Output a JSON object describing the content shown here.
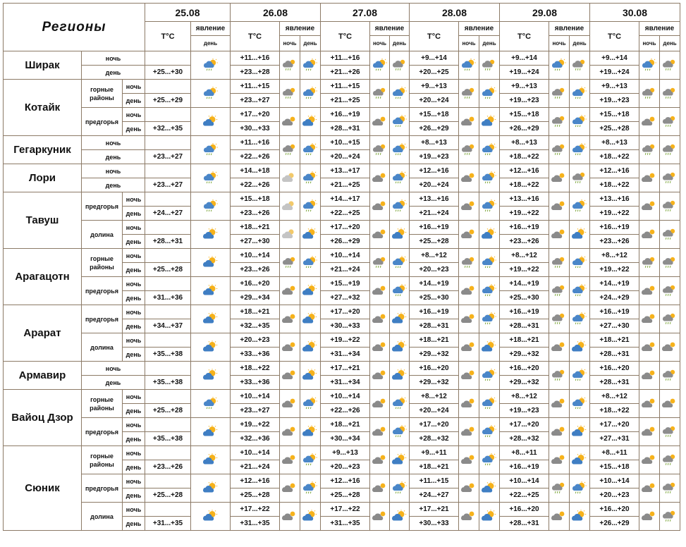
{
  "header": {
    "regions_title": "Регионы",
    "temp_label": "Т°С",
    "phenomenon_label": "явление",
    "night_label": "ночь",
    "day_label": "день",
    "dates": [
      "25.08",
      "26.08",
      "27.08",
      "28.08",
      "29.08",
      "30.08"
    ]
  },
  "labels": {
    "night": "ночь",
    "day": "день",
    "mountain": "горные районы",
    "foothills": "предгорья",
    "valley": "долина"
  },
  "regions": [
    {
      "name": "Ширак",
      "zones": [
        {
          "zone": "",
          "temps": [
            {
              "night": "",
              "day": "+25...+30"
            },
            {
              "night": "+11...+16",
              "day": "+23...+28"
            },
            {
              "night": "+11...+16",
              "day": "+21...+26"
            },
            {
              "night": "+9...+14",
              "day": "+20...+25"
            },
            {
              "night": "+9...+14",
              "day": "+19...+24"
            },
            {
              "night": "+9...+14",
              "day": "+19...+24"
            }
          ],
          "icons": [
            "sun-cloud-rain-icon",
            "rain-cloud-icon",
            "sun-cloud-rain-icon",
            "sun-cloud-rain-icon",
            "rain-cloud-icon",
            "sun-cloud-rain-icon",
            "rain-cloud-icon",
            "sun-cloud-rain-icon",
            "rain-cloud-icon",
            "sun-cloud-rain-icon",
            "rain-cloud-icon"
          ]
        }
      ]
    },
    {
      "name": "Котайк",
      "zones": [
        {
          "zone": "mountain",
          "temps": [
            {
              "night": "",
              "day": "+25...+29"
            },
            {
              "night": "+11...+15",
              "day": "+23...+27"
            },
            {
              "night": "+11...+15",
              "day": "+21...+25"
            },
            {
              "night": "+9...+13",
              "day": "+20...+24"
            },
            {
              "night": "+9...+13",
              "day": "+19...+23"
            },
            {
              "night": "+9...+13",
              "day": "+19...+23"
            }
          ],
          "icons": [
            "sun-cloud-rain-icon",
            "rain-cloud-icon",
            "sun-cloud-rain-icon",
            "rain-cloud-icon",
            "sun-cloud-rain-icon",
            "rain-cloud-icon",
            "sun-cloud-rain-icon",
            "rain-cloud-icon",
            "sun-cloud-rain-icon",
            "rain-cloud-icon",
            "rain-cloud-icon"
          ]
        },
        {
          "zone": "foothills",
          "temps": [
            {
              "night": "",
              "day": "+32...+35"
            },
            {
              "night": "+17...+20",
              "day": "+30...+33"
            },
            {
              "night": "+16...+19",
              "day": "+28...+31"
            },
            {
              "night": "+15...+18",
              "day": "+26...+29"
            },
            {
              "night": "+15...+18",
              "day": "+26...+29"
            },
            {
              "night": "+15...+18",
              "day": "+25...+28"
            }
          ],
          "icons": [
            "sun-cloud-icon",
            "cloud-icon",
            "sun-cloud-icon",
            "cloud-icon",
            "sun-cloud-rain-icon",
            "cloud-icon",
            "sun-cloud-icon",
            "rain-cloud-icon",
            "sun-cloud-rain-icon",
            "cloud-icon",
            "rain-cloud-icon"
          ]
        }
      ]
    },
    {
      "name": "Гегаркуник",
      "zones": [
        {
          "zone": "",
          "temps": [
            {
              "night": "",
              "day": "+23...+27"
            },
            {
              "night": "+11...+16",
              "day": "+22...+26"
            },
            {
              "night": "+10...+15",
              "day": "+20...+24"
            },
            {
              "night": "+8...+13",
              "day": "+19...+23"
            },
            {
              "night": "+8...+13",
              "day": "+18...+22"
            },
            {
              "night": "+8...+13",
              "day": "+18...+22"
            }
          ],
          "icons": [
            "sun-cloud-rain-icon",
            "rain-cloud-icon",
            "sun-cloud-rain-icon",
            "rain-cloud-icon",
            "sun-cloud-rain-icon",
            "rain-cloud-icon",
            "sun-cloud-rain-icon",
            "rain-cloud-icon",
            "sun-cloud-rain-icon",
            "rain-cloud-icon",
            "rain-cloud-icon"
          ]
        }
      ]
    },
    {
      "name": "Лори",
      "zones": [
        {
          "zone": "",
          "temps": [
            {
              "night": "",
              "day": "+23...+27"
            },
            {
              "night": "+14...+18",
              "day": "+22...+26"
            },
            {
              "night": "+13...+17",
              "day": "+21...+25"
            },
            {
              "night": "+12...+16",
              "day": "+20...+24"
            },
            {
              "night": "+12...+16",
              "day": "+18...+22"
            },
            {
              "night": "+12...+16",
              "day": "+18...+22"
            }
          ],
          "icons": [
            "sun-cloud-rain-icon",
            "moon-cloud-icon",
            "sun-cloud-rain-icon",
            "cloud-icon",
            "sun-cloud-rain-icon",
            "cloud-icon",
            "sun-cloud-rain-icon",
            "cloud-icon",
            "rain-cloud-icon",
            "cloud-icon",
            "rain-cloud-icon"
          ]
        }
      ]
    },
    {
      "name": "Тавуш",
      "zones": [
        {
          "zone": "foothills",
          "temps": [
            {
              "night": "",
              "day": "+24...+27"
            },
            {
              "night": "+15...+18",
              "day": "+23...+26"
            },
            {
              "night": "+14...+17",
              "day": "+22...+25"
            },
            {
              "night": "+13...+16",
              "day": "+21...+24"
            },
            {
              "night": "+13...+16",
              "day": "+19...+22"
            },
            {
              "night": "+13...+16",
              "day": "+19...+22"
            }
          ],
          "icons": [
            "sun-cloud-rain-icon",
            "moon-cloud-icon",
            "sun-cloud-rain-icon",
            "cloud-icon",
            "sun-cloud-rain-icon",
            "cloud-icon",
            "sun-cloud-rain-icon",
            "cloud-icon",
            "sun-cloud-rain-icon",
            "cloud-icon",
            "rain-cloud-icon"
          ]
        },
        {
          "zone": "valley",
          "temps": [
            {
              "night": "",
              "day": "+28...+31"
            },
            {
              "night": "+18...+21",
              "day": "+27...+30"
            },
            {
              "night": "+17...+20",
              "day": "+26...+29"
            },
            {
              "night": "+16...+19",
              "day": "+25...+28"
            },
            {
              "night": "+16...+19",
              "day": "+23...+26"
            },
            {
              "night": "+16...+19",
              "day": "+23...+26"
            }
          ],
          "icons": [
            "sun-cloud-icon",
            "moon-cloud-icon",
            "sun-cloud-icon",
            "cloud-icon",
            "sun-cloud-icon",
            "cloud-icon",
            "sun-cloud-icon",
            "cloud-icon",
            "sun-cloud-icon",
            "cloud-icon",
            "rain-cloud-icon"
          ]
        }
      ]
    },
    {
      "name": "Арагацотн",
      "zones": [
        {
          "zone": "mountain",
          "temps": [
            {
              "night": "",
              "day": "+25...+28"
            },
            {
              "night": "+10...+14",
              "day": "+23...+26"
            },
            {
              "night": "+10...+14",
              "day": "+21...+24"
            },
            {
              "night": "+8...+12",
              "day": "+20...+23"
            },
            {
              "night": "+8...+12",
              "day": "+19...+22"
            },
            {
              "night": "+8...+12",
              "day": "+19...+22"
            }
          ],
          "icons": [
            "sun-cloud-icon",
            "rain-cloud-icon",
            "sun-cloud-rain-icon",
            "rain-cloud-icon",
            "sun-cloud-rain-icon",
            "rain-cloud-icon",
            "sun-cloud-rain-icon",
            "rain-cloud-icon",
            "sun-cloud-rain-icon",
            "rain-cloud-icon",
            "rain-cloud-icon"
          ]
        },
        {
          "zone": "foothills",
          "temps": [
            {
              "night": "",
              "day": "+31...+36"
            },
            {
              "night": "+16...+20",
              "day": "+29...+34"
            },
            {
              "night": "+15...+19",
              "day": "+27...+32"
            },
            {
              "night": "+14...+19",
              "day": "+25...+30"
            },
            {
              "night": "+14...+19",
              "day": "+25...+30"
            },
            {
              "night": "+14...+19",
              "day": "+24...+29"
            }
          ],
          "icons": [
            "sun-cloud-icon",
            "cloud-icon",
            "sun-cloud-icon",
            "cloud-icon",
            "sun-cloud-rain-icon",
            "cloud-icon",
            "sun-cloud-rain-icon",
            "rain-cloud-icon",
            "sun-cloud-rain-icon",
            "cloud-icon",
            "rain-cloud-icon"
          ]
        }
      ]
    },
    {
      "name": "Арарат",
      "zones": [
        {
          "zone": "foothills",
          "temps": [
            {
              "night": "",
              "day": "+34...+37"
            },
            {
              "night": "+18...+21",
              "day": "+32...+35"
            },
            {
              "night": "+17...+20",
              "day": "+30...+33"
            },
            {
              "night": "+16...+19",
              "day": "+28...+31"
            },
            {
              "night": "+16...+19",
              "day": "+28...+31"
            },
            {
              "night": "+16...+19",
              "day": "+27...+30"
            }
          ],
          "icons": [
            "sun-cloud-icon",
            "cloud-icon",
            "sun-cloud-icon",
            "cloud-icon",
            "sun-cloud-icon",
            "cloud-icon",
            "sun-cloud-rain-icon",
            "rain-cloud-icon",
            "sun-cloud-rain-icon",
            "cloud-icon",
            "rain-cloud-icon"
          ]
        },
        {
          "zone": "valley",
          "temps": [
            {
              "night": "",
              "day": "+35...+38"
            },
            {
              "night": "+20...+23",
              "day": "+33...+36"
            },
            {
              "night": "+19...+22",
              "day": "+31...+34"
            },
            {
              "night": "+18...+21",
              "day": "+29...+32"
            },
            {
              "night": "+18...+21",
              "day": "+29...+32"
            },
            {
              "night": "+18...+21",
              "day": "+28...+31"
            }
          ],
          "icons": [
            "sun-cloud-icon",
            "cloud-icon",
            "sun-cloud-icon",
            "cloud-icon",
            "sun-cloud-icon",
            "cloud-icon",
            "sun-cloud-icon",
            "cloud-icon",
            "sun-cloud-icon",
            "cloud-icon",
            "cloud-icon"
          ]
        }
      ]
    },
    {
      "name": "Армавир",
      "zones": [
        {
          "zone": "",
          "temps": [
            {
              "night": "",
              "day": "+35...+38"
            },
            {
              "night": "+18...+22",
              "day": "+33...+36"
            },
            {
              "night": "+17...+21",
              "day": "+31...+34"
            },
            {
              "night": "+16...+20",
              "day": "+29...+32"
            },
            {
              "night": "+16...+20",
              "day": "+29...+32"
            },
            {
              "night": "+16...+20",
              "day": "+28...+31"
            }
          ],
          "icons": [
            "sun-cloud-icon",
            "cloud-icon",
            "sun-cloud-icon",
            "cloud-icon",
            "sun-cloud-icon",
            "cloud-icon",
            "sun-cloud-rain-icon",
            "rain-cloud-icon",
            "sun-cloud-rain-icon",
            "cloud-icon",
            "rain-cloud-icon"
          ]
        }
      ]
    },
    {
      "name": "Вайоц Дзор",
      "zones": [
        {
          "zone": "mountain",
          "temps": [
            {
              "night": "",
              "day": "+25...+28"
            },
            {
              "night": "+10...+14",
              "day": "+23...+27"
            },
            {
              "night": "+10...+14",
              "day": "+22...+26"
            },
            {
              "night": "+8...+12",
              "day": "+20...+24"
            },
            {
              "night": "+8...+12",
              "day": "+19...+23"
            },
            {
              "night": "+8...+12",
              "day": "+18...+22"
            }
          ],
          "icons": [
            "sun-cloud-rain-icon",
            "cloud-icon",
            "sun-cloud-rain-icon",
            "cloud-icon",
            "sun-cloud-rain-icon",
            "cloud-icon",
            "sun-cloud-rain-icon",
            "cloud-icon",
            "sun-cloud-rain-icon",
            "cloud-icon",
            "cloud-icon"
          ]
        },
        {
          "zone": "foothills",
          "temps": [
            {
              "night": "",
              "day": "+35...+38"
            },
            {
              "night": "+19...+22",
              "day": "+32...+36"
            },
            {
              "night": "+18...+21",
              "day": "+30...+34"
            },
            {
              "night": "+17...+20",
              "day": "+28...+32"
            },
            {
              "night": "+17...+20",
              "day": "+28...+32"
            },
            {
              "night": "+17...+20",
              "day": "+27...+31"
            }
          ],
          "icons": [
            "sun-cloud-icon",
            "cloud-icon",
            "sun-cloud-icon",
            "cloud-icon",
            "sun-cloud-rain-icon",
            "cloud-icon",
            "sun-cloud-rain-icon",
            "cloud-icon",
            "sun-cloud-icon",
            "cloud-icon",
            "rain-cloud-icon"
          ]
        }
      ]
    },
    {
      "name": "Сюник",
      "zones": [
        {
          "zone": "mountain",
          "temps": [
            {
              "night": "",
              "day": "+23...+26"
            },
            {
              "night": "+10...+14",
              "day": "+21...+24"
            },
            {
              "night": "+9...+13",
              "day": "+20...+23"
            },
            {
              "night": "+9...+11",
              "day": "+18...+21"
            },
            {
              "night": "+8...+11",
              "day": "+16...+19"
            },
            {
              "night": "+8...+11",
              "day": "+15...+18"
            }
          ],
          "icons": [
            "sun-cloud-icon",
            "cloud-icon",
            "sun-cloud-rain-icon",
            "cloud-icon",
            "sun-cloud-icon",
            "cloud-icon",
            "sun-cloud-rain-icon",
            "cloud-icon",
            "sun-cloud-icon",
            "cloud-icon",
            "rain-cloud-icon"
          ]
        },
        {
          "zone": "foothills",
          "temps": [
            {
              "night": "",
              "day": "+25...+28"
            },
            {
              "night": "+12...+16",
              "day": "+25...+28"
            },
            {
              "night": "+12...+16",
              "day": "+25...+28"
            },
            {
              "night": "+11...+15",
              "day": "+24...+27"
            },
            {
              "night": "+10...+14",
              "day": "+22...+25"
            },
            {
              "night": "+10...+14",
              "day": "+20...+23"
            }
          ],
          "icons": [
            "sun-cloud-icon",
            "cloud-icon",
            "sun-cloud-rain-icon",
            "cloud-icon",
            "sun-cloud-rain-icon",
            "cloud-icon",
            "sun-cloud-icon",
            "rain-cloud-icon",
            "sun-cloud-rain-icon",
            "cloud-icon",
            "rain-cloud-icon"
          ]
        },
        {
          "zone": "valley",
          "temps": [
            {
              "night": "",
              "day": "+31...+35"
            },
            {
              "night": "+17...+22",
              "day": "+31...+35"
            },
            {
              "night": "+17...+22",
              "day": "+31...+35"
            },
            {
              "night": "+17...+21",
              "day": "+30...+33"
            },
            {
              "night": "+16...+20",
              "day": "+28...+31"
            },
            {
              "night": "+16...+20",
              "day": "+26...+29"
            }
          ],
          "icons": [
            "sun-cloud-icon",
            "cloud-icon",
            "sun-cloud-icon",
            "cloud-icon",
            "sun-cloud-icon",
            "cloud-icon",
            "sun-cloud-icon",
            "cloud-icon",
            "sun-cloud-icon",
            "cloud-icon",
            "rain-cloud-icon"
          ]
        }
      ]
    }
  ]
}
